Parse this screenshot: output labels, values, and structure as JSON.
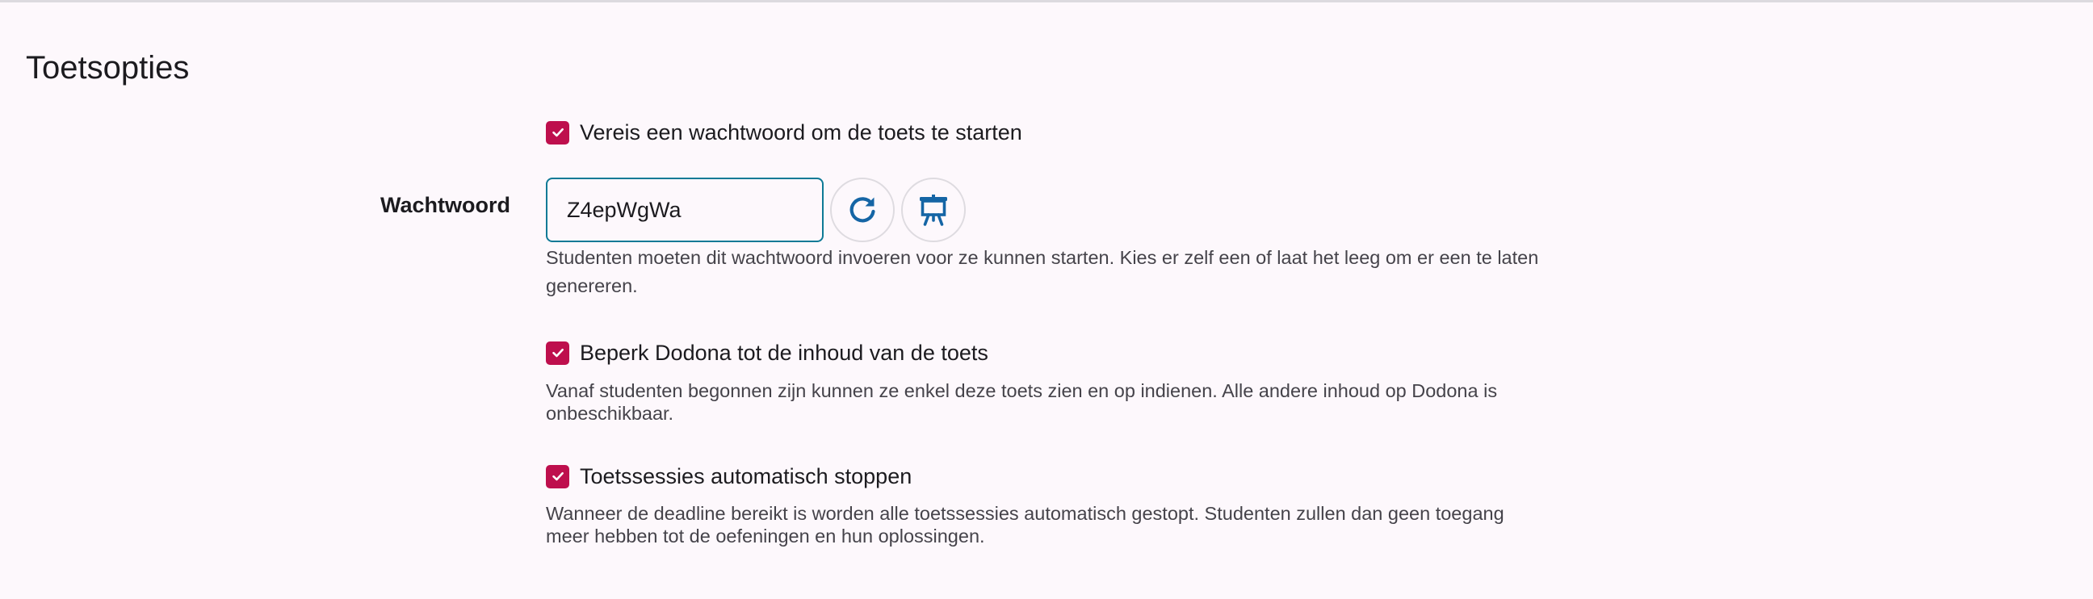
{
  "section": {
    "title": "Toetsopties"
  },
  "options": {
    "require_password": {
      "label": "Vereis een wachtwoord om de toets te starten",
      "checked": true
    },
    "password": {
      "label": "Wachtwoord",
      "value": "Z4epWgWa",
      "refresh_icon": "refresh-icon",
      "present_icon": "presentation-icon",
      "help": "Studenten moeten dit wachtwoord invoeren voor ze kunnen starten. Kies er zelf een of laat het leeg om er een te laten genereren."
    },
    "restrict_dodona": {
      "label": "Beperk Dodona tot de inhoud van de toets",
      "checked": true,
      "help": "Vanaf studenten begonnen zijn kunnen ze enkel deze toets zien en op indienen. Alle andere inhoud op Dodona is onbeschikbaar."
    },
    "auto_stop": {
      "label": "Toetssessies automatisch stoppen",
      "checked": true,
      "help": "Wanneer de deadline bereikt is worden alle toetssessies automatisch gestopt. Studenten zullen dan geen toegang meer hebben tot de oefeningen en hun oplossingen."
    }
  },
  "colors": {
    "checkbox": "#be0f4d",
    "input_border": "#0e7a96",
    "icon": "#1565a5",
    "background": "#fdf8fc"
  }
}
